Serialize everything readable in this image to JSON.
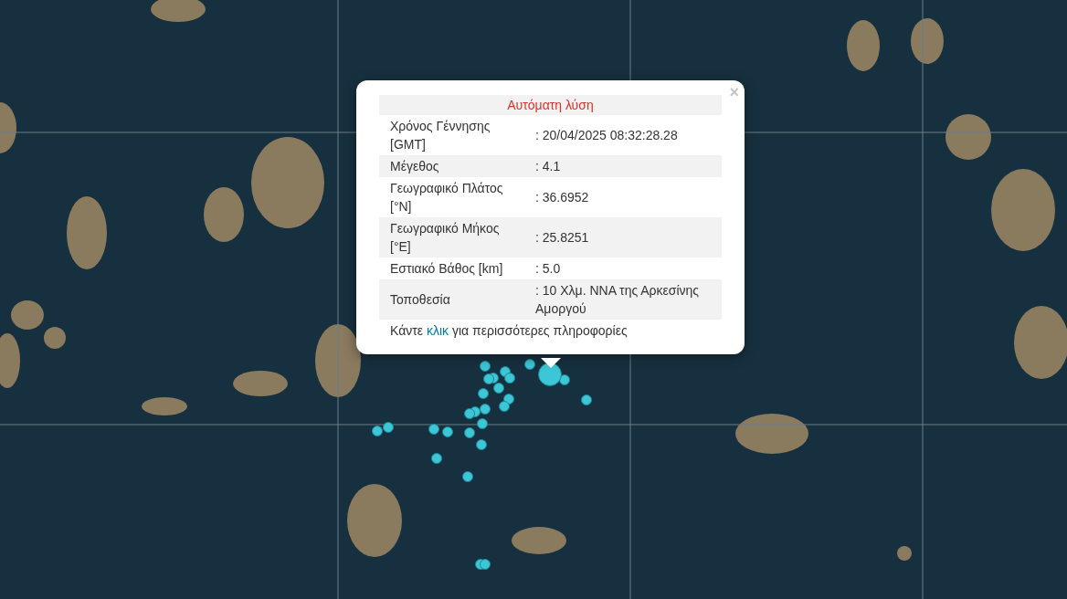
{
  "popup": {
    "title": "Αυτόματη λύση",
    "close": "×",
    "rows": [
      {
        "label": "Χρόνος Γέννησης [GMT]",
        "value": ": 20/04/2025 08:32:28.28"
      },
      {
        "label": "Μέγεθος",
        "value": ": 4.1"
      },
      {
        "label": "Γεωγραφικό Πλάτος [°N]",
        "value": ": 36.6952"
      },
      {
        "label": "Γεωγραφικό Μήκος [°E]",
        "value": ": 25.8251"
      },
      {
        "label": "Εστιακό Βάθος [km]",
        "value": ": 5.0"
      },
      {
        "label": "Τοποθεσία",
        "value": ": 10 Χλμ. ΝΝΑ της Αρκεσίνης Αμοργού"
      }
    ],
    "footer": {
      "before": "Κάντε",
      "link": "κλικ",
      "after": "για περισσότερες πληροφορίες"
    }
  }
}
